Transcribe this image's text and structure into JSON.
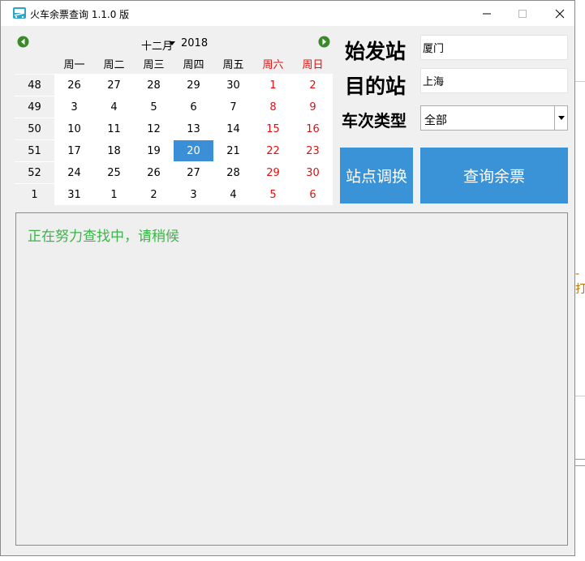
{
  "window": {
    "title": "火车余票查询 1.1.0 版"
  },
  "calendar": {
    "month": "十二月",
    "year": "2018",
    "weekdays": [
      "周一",
      "周二",
      "周三",
      "周四",
      "周五",
      "周六",
      "周日"
    ],
    "weeks": [
      {
        "wk": "48",
        "days": [
          "26",
          "27",
          "28",
          "29",
          "30",
          "1",
          "2"
        ]
      },
      {
        "wk": "49",
        "days": [
          "3",
          "4",
          "5",
          "6",
          "7",
          "8",
          "9"
        ]
      },
      {
        "wk": "50",
        "days": [
          "10",
          "11",
          "12",
          "13",
          "14",
          "15",
          "16"
        ]
      },
      {
        "wk": "51",
        "days": [
          "17",
          "18",
          "19",
          "20",
          "21",
          "22",
          "23"
        ]
      },
      {
        "wk": "52",
        "days": [
          "24",
          "25",
          "26",
          "27",
          "28",
          "29",
          "30"
        ]
      },
      {
        "wk": "1",
        "days": [
          "31",
          "1",
          "2",
          "3",
          "4",
          "5",
          "6"
        ]
      }
    ],
    "selected_day": "20"
  },
  "form": {
    "from_label": "始发站",
    "from_value": "厦门",
    "to_label": "目的站",
    "to_value": "上海",
    "type_label": "车次类型",
    "type_value": "全部"
  },
  "buttons": {
    "swap": "站点调换",
    "query": "查询余票"
  },
  "result": {
    "status": "正在努力查找中，请稍候"
  },
  "colors": {
    "accent": "#3a93d6",
    "weekend": "#e01010",
    "status": "#3cb44a"
  },
  "background_fragments": {
    "left_r1": "R",
    "left_r2": "F",
    "left_s": "S",
    "right_char": "-打"
  }
}
